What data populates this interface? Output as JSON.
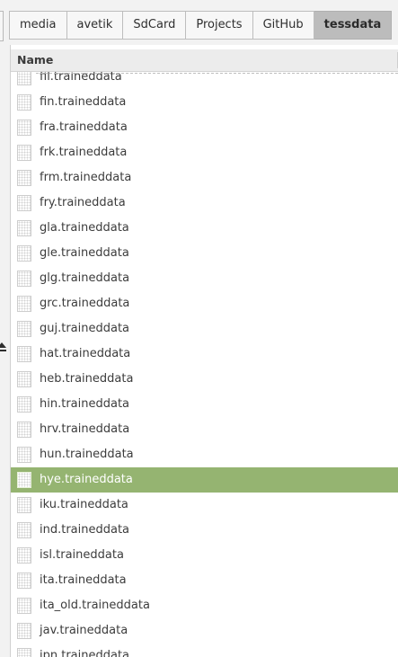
{
  "pathbar": {
    "crumbs": [
      "media",
      "avetik",
      "SdCard",
      "Projects",
      "GitHub",
      "tessdata"
    ],
    "active_index": 5
  },
  "list": {
    "header": {
      "name_label": "Name"
    },
    "selected_index": 16,
    "selection_color": "#95b471",
    "files": [
      "fil.traineddata",
      "fin.traineddata",
      "fra.traineddata",
      "frk.traineddata",
      "frm.traineddata",
      "fry.traineddata",
      "gla.traineddata",
      "gle.traineddata",
      "glg.traineddata",
      "grc.traineddata",
      "guj.traineddata",
      "hat.traineddata",
      "heb.traineddata",
      "hin.traineddata",
      "hrv.traineddata",
      "hun.traineddata",
      "hye.traineddata",
      "iku.traineddata",
      "ind.traineddata",
      "isl.traineddata",
      "ita.traineddata",
      "ita_old.traineddata",
      "jav.traineddata",
      "jpn.traineddata"
    ]
  },
  "icons": {
    "file": "file-icon",
    "eject": "eject-icon"
  }
}
